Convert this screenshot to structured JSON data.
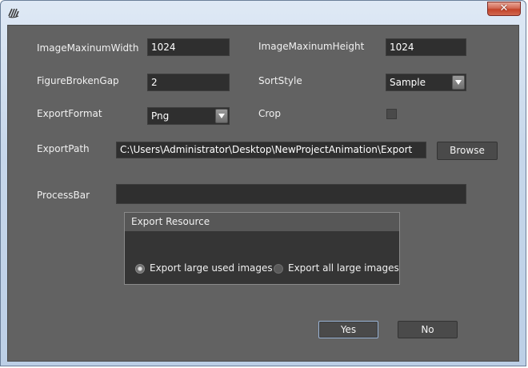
{
  "window": {
    "close_glyph": "✕"
  },
  "form": {
    "image_max_width": {
      "label": "ImageMaxinumWidth",
      "value": "1024"
    },
    "image_max_height": {
      "label": "ImageMaxinumHeight",
      "value": "1024"
    },
    "figure_broken_gap": {
      "label": "FigureBrokenGap",
      "value": "2"
    },
    "sort_style": {
      "label": "SortStyle",
      "value": "Sample"
    },
    "export_format": {
      "label": "ExportFormat",
      "value": "Png"
    },
    "crop": {
      "label": "Crop",
      "checked": false
    },
    "export_path": {
      "label": "ExportPath",
      "value": "C:\\Users\\Administrator\\Desktop\\NewProjectAnimation\\Export",
      "browse_label": "Browse"
    },
    "process_bar": {
      "label": "ProcessBar",
      "progress": 0
    }
  },
  "export_resource": {
    "title": "Export Resource",
    "options": [
      {
        "label": "Export large used images",
        "selected": true
      },
      {
        "label": "Export all large images",
        "selected": false
      }
    ]
  },
  "actions": {
    "yes_label": "Yes",
    "no_label": "No"
  }
}
